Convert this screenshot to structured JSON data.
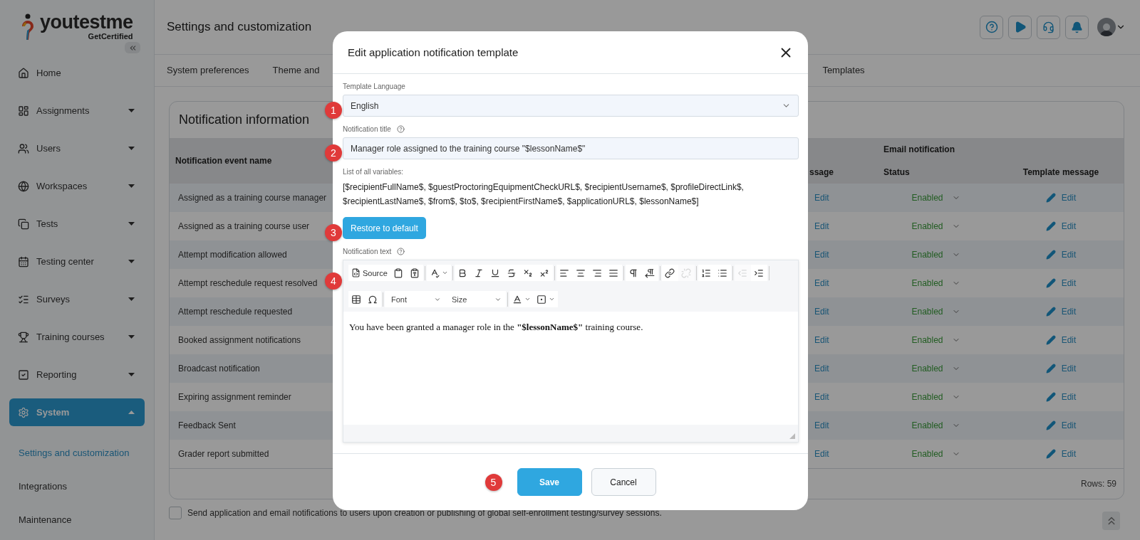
{
  "sidebar": {
    "logo": {
      "name": "youtestme",
      "tagline": "GetCertified"
    },
    "items": [
      {
        "label": "Home",
        "kind": "link",
        "selected": false
      },
      {
        "label": "Assignments",
        "kind": "group",
        "selected": false,
        "expanded": false
      },
      {
        "label": "Users",
        "kind": "group",
        "selected": false,
        "expanded": false
      },
      {
        "label": "Workspaces",
        "kind": "group",
        "selected": false,
        "expanded": false
      },
      {
        "label": "Tests",
        "kind": "group",
        "selected": false,
        "expanded": false
      },
      {
        "label": "Testing center",
        "kind": "group",
        "selected": false,
        "expanded": false
      },
      {
        "label": "Surveys",
        "kind": "group",
        "selected": false,
        "expanded": false
      },
      {
        "label": "Training courses",
        "kind": "group",
        "selected": false,
        "expanded": false
      },
      {
        "label": "Reporting",
        "kind": "group",
        "selected": false,
        "expanded": false
      },
      {
        "label": "System",
        "kind": "group",
        "selected": true,
        "expanded": true,
        "children": [
          {
            "label": "Settings and customization",
            "selected": true
          },
          {
            "label": "Integrations",
            "selected": false
          },
          {
            "label": "Maintenance",
            "selected": false
          }
        ]
      }
    ]
  },
  "header": {
    "title": "Settings and customization"
  },
  "tabs": [
    {
      "label": "System preferences",
      "selected": false
    },
    {
      "label": "Theme and",
      "selected": false
    },
    {
      "label": "Templates",
      "selected": false
    }
  ],
  "card": {
    "title": "Notification information",
    "group_header": "Email notification",
    "columns": [
      "Notification event name",
      "ssage",
      "Status",
      "Template message"
    ],
    "rows": [
      {
        "name": "Assigned as a training course manager",
        "column_2": "Edit",
        "status": "Enabled",
        "template": "Edit"
      },
      {
        "name": "Assigned as a training course user",
        "column_2": "Edit",
        "status": "Enabled",
        "template": "Edit"
      },
      {
        "name": "Attempt modification allowed",
        "column_2": "Edit",
        "status": "Enabled",
        "template": "Edit"
      },
      {
        "name": "Attempt reschedule request resolved",
        "column_2": "Edit",
        "status": "Enabled",
        "template": "Edit"
      },
      {
        "name": "Attempt reschedule requested",
        "column_2": "Edit",
        "status": "Enabled",
        "template": "Edit"
      },
      {
        "name": "Booked assignment notifications",
        "column_2": "Edit",
        "status": "Enabled",
        "template": "Edit"
      },
      {
        "name": "Broadcast notification",
        "column_2": "Edit",
        "status": "Enabled",
        "template": "Edit"
      },
      {
        "name": "Expiring assignment reminder",
        "column_2": "Edit",
        "status": "Enabled",
        "template": "Edit"
      },
      {
        "name": "Feedback Sent",
        "column_2": "Edit",
        "status": "Enabled",
        "template": "Edit"
      },
      {
        "name": "Grader report submitted",
        "column_2": "Edit",
        "status": "Enabled",
        "template": "Edit"
      }
    ],
    "footer": "Rows: 59"
  },
  "self_enrollment": {
    "label": "Send application and email notifications to users upon creation or publishing of global self-enrollment testing/survey sessions.",
    "checked": false
  },
  "modal": {
    "title": "Edit application notification template",
    "language": {
      "label": "Template Language",
      "value": "English",
      "marker": "1"
    },
    "notification_title": {
      "label": "Notification title",
      "value": "Manager role assigned to the training course \"$lessonName$\"",
      "marker": "2"
    },
    "variables": {
      "label": "List of all variables:",
      "text": "[$recipientFullName$, $guestProctoringEquipmentCheckURL$, $recipientUsername$, $profileDirectLink$, $recipientLastName$, $from$, $to$, $recipientFirstName$, $applicationURL$, $lessonName$]"
    },
    "restore_button": {
      "label": "Restore to default",
      "marker": "3"
    },
    "editor": {
      "label": "Notification text",
      "marker": "4",
      "toolbar": [
        {
          "kind": "source",
          "label": "Source",
          "disabled": false
        },
        {
          "kind": "button",
          "disabled": false
        },
        {
          "kind": "button",
          "disabled": false
        },
        {
          "kind": "separator"
        },
        {
          "kind": "menu",
          "disabled": false
        },
        {
          "kind": "separator"
        },
        {
          "kind": "button",
          "disabled": false
        },
        {
          "kind": "button",
          "disabled": false
        },
        {
          "kind": "button",
          "disabled": false
        },
        {
          "kind": "button",
          "disabled": false
        },
        {
          "kind": "button",
          "disabled": false
        },
        {
          "kind": "button",
          "disabled": false
        },
        {
          "kind": "separator"
        },
        {
          "kind": "button",
          "disabled": false
        },
        {
          "kind": "button",
          "disabled": false
        },
        {
          "kind": "button",
          "disabled": false
        },
        {
          "kind": "button",
          "disabled": false
        },
        {
          "kind": "separator"
        },
        {
          "kind": "button",
          "disabled": false
        },
        {
          "kind": "button",
          "disabled": false
        },
        {
          "kind": "separator"
        },
        {
          "kind": "button",
          "disabled": false
        },
        {
          "kind": "button",
          "disabled": true
        },
        {
          "kind": "separator"
        },
        {
          "kind": "button",
          "disabled": false
        },
        {
          "kind": "button",
          "disabled": false
        },
        {
          "kind": "separator"
        },
        {
          "kind": "button",
          "disabled": true
        },
        {
          "kind": "button",
          "disabled": false
        },
        {
          "kind": "separator"
        },
        {
          "kind": "break"
        },
        {
          "kind": "button",
          "disabled": false
        },
        {
          "kind": "button",
          "disabled": false
        },
        {
          "kind": "separator"
        },
        {
          "kind": "combo",
          "label": "Font",
          "disabled": false
        },
        {
          "kind": "combo",
          "label": "Size",
          "disabled": false
        },
        {
          "kind": "separator"
        },
        {
          "kind": "menu",
          "disabled": false
        },
        {
          "kind": "menu",
          "disabled": false
        }
      ],
      "content": "You have been granted a manager role in the **\"$lessonName$\"** training course."
    },
    "buttons": [
      {
        "label": "Save",
        "kind": "primary",
        "marker": "5"
      },
      {
        "label": "Cancel",
        "kind": "secondary"
      }
    ]
  }
}
